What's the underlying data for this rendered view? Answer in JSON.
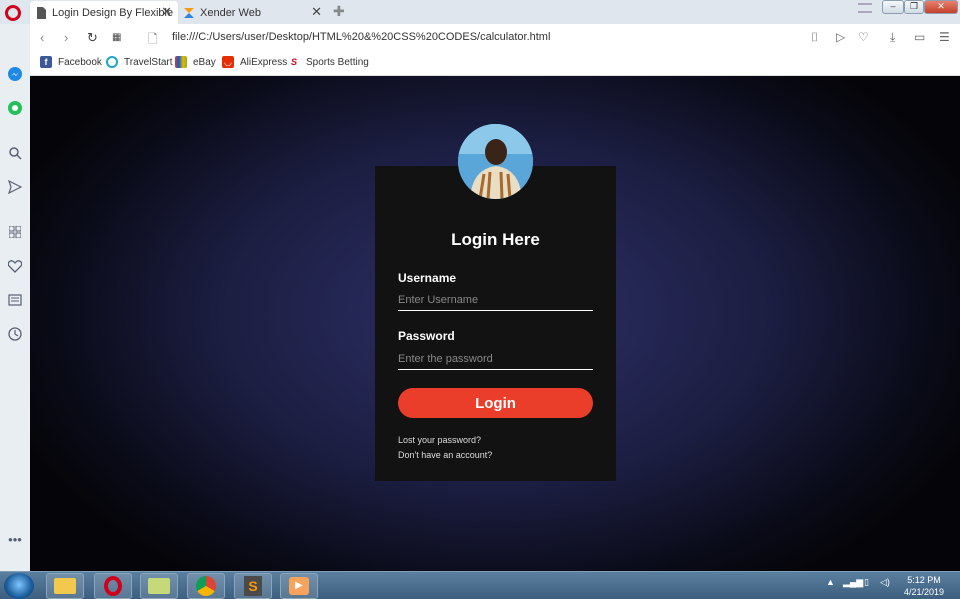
{
  "browser": {
    "tabs": [
      {
        "label": "Login Design By Flexible"
      },
      {
        "label": "Xender Web"
      }
    ],
    "url": "file:///C:/Users/user/Desktop/HTML%20&%20CSS%20CODES/calculator.html",
    "bookmarks": [
      {
        "label": "Facebook"
      },
      {
        "label": "TravelStart"
      },
      {
        "label": "eBay"
      },
      {
        "label": "AliExpress"
      },
      {
        "label": "Sports Betting"
      }
    ]
  },
  "login": {
    "title": "Login Here",
    "username_label": "Username",
    "username_placeholder": "Enter Username",
    "password_label": "Password",
    "password_placeholder": "Enter the password",
    "button": "Login",
    "lost_password": "Lost your password?",
    "no_account": "Don't have an account?"
  },
  "taskbar": {
    "time": "5:12 PM",
    "date": "4/21/2019"
  },
  "colors": {
    "accent": "#ea3e2b",
    "card": "#121212",
    "background": "#1b1d40"
  }
}
